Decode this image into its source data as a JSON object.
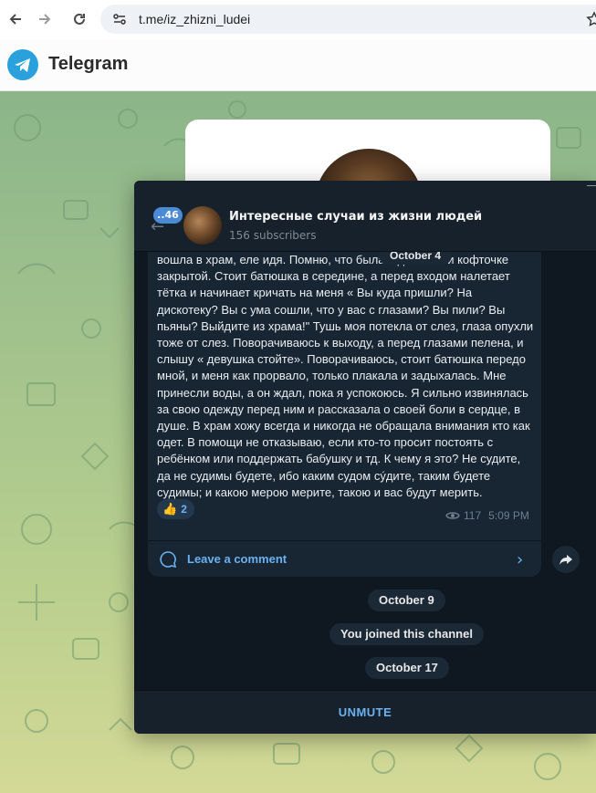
{
  "browser": {
    "url": "t.me/iz_zhizni_ludei",
    "icons": [
      "back-arrow-icon",
      "forward-arrow-icon",
      "reload-icon",
      "site-settings-icon",
      "bookmark-star-icon"
    ]
  },
  "header": {
    "app_title": "Telegram",
    "logo_icon": "telegram-plane-icon"
  },
  "channel": {
    "unread_badge": "..46",
    "name": "Интересные случаи из жизни людей",
    "subscribers": "156 subscribers"
  },
  "message": {
    "floating_date": "October 4",
    "text": "вошла в храм, еле идя. Помню, что была в джинсах и кофточке закрытой. Стоит батюшка в середине, а перед входом налетает тётка и начинает кричать на меня « Вы куда пришли? На дискотеку? Вы с ума сошли, что у вас с глазами? Вы пили? Вы пьяны? Выйдите из храма!\" Тушь моя потекла от слез, глаза опухли тоже от слез. Поворачиваюсь к выходу, а перед глазами пелена, и слышу « девушка стойте». Поворачиваюсь, стоит батюшка передо мной, и меня как прорвало, только плакала и задыхалась. Мне принесли воды, а он ждал, пока я успокоюсь. Я сильно извинялась за свою одежду перед ним и рассказала о своей боли в сердце, в душе. В храм хожу всегда и никогда не обращала внимания кто как одет. В помощи не отказываю, если кто-то просит постоять с ребёнком или поддержать бабушку и тд. К чему я это? Не судите, да не судимы будете, ибо каким судом сýдите, таким будете судимы; и какою мерою мерите, такою и вас будут мерить.",
    "reaction": {
      "emoji": "👍",
      "count": "2"
    },
    "views": "117",
    "time": "5:09 PM",
    "comment_label": "Leave a comment"
  },
  "service_messages": {
    "date_1": "October 9",
    "joined": "You joined this channel",
    "date_2": "October 17"
  },
  "bottom": {
    "unmute_label": "UNMUTE"
  },
  "colors": {
    "accent": "#6ab2f2",
    "window_bg": "#0f1721",
    "bubble_bg": "#182533",
    "telegram_blue": "#2aa1da"
  }
}
